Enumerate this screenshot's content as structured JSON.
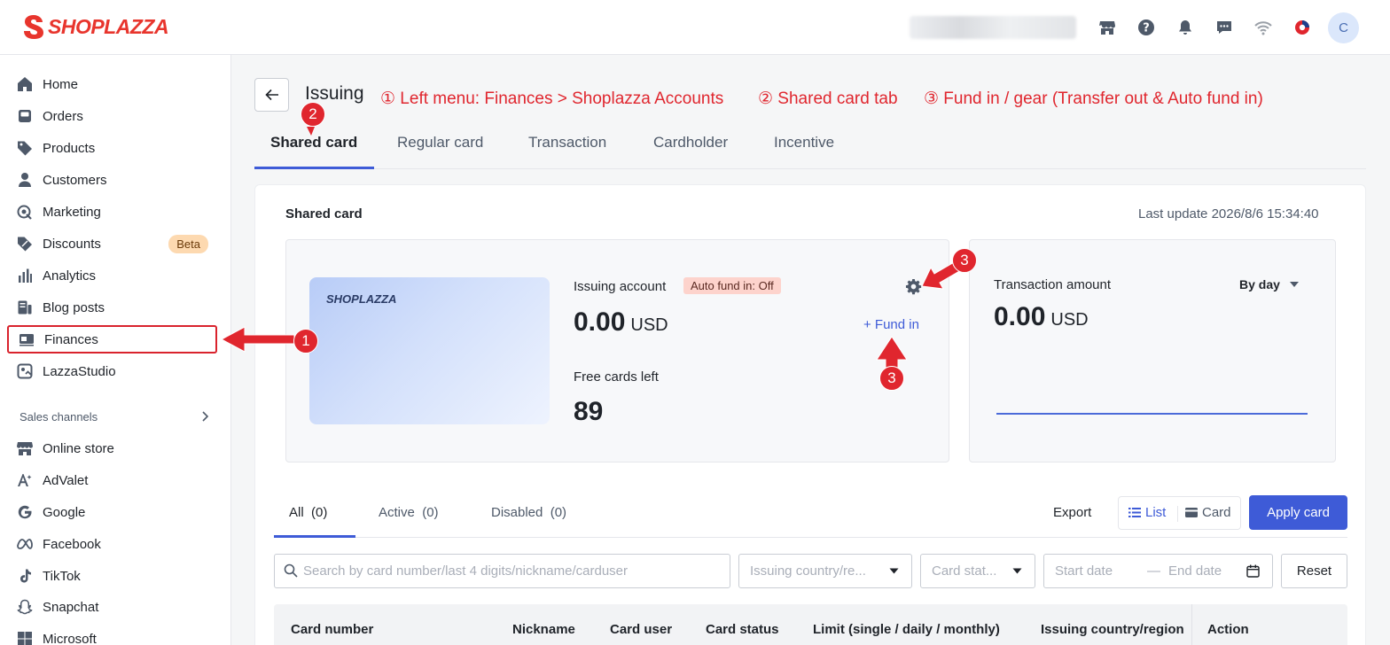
{
  "brand": {
    "name": "SHOPLAZZA"
  },
  "topbar": {
    "icons": [
      "store-icon",
      "help-icon",
      "bell-icon",
      "chat-icon",
      "wifi-icon",
      "app-icon"
    ],
    "avatar_initial": "C"
  },
  "sidebar": {
    "items": [
      {
        "label": "Home",
        "icon": "home-icon"
      },
      {
        "label": "Orders",
        "icon": "orders-icon"
      },
      {
        "label": "Products",
        "icon": "tag-icon"
      },
      {
        "label": "Customers",
        "icon": "person-icon"
      },
      {
        "label": "Marketing",
        "icon": "marketing-icon"
      },
      {
        "label": "Discounts",
        "icon": "discount-icon",
        "badge": "Beta"
      },
      {
        "label": "Analytics",
        "icon": "bar-chart-icon"
      },
      {
        "label": "Blog posts",
        "icon": "blog-icon"
      },
      {
        "label": "Finances",
        "icon": "finance-icon",
        "selected": true
      },
      {
        "label": "LazzaStudio",
        "icon": "studio-icon"
      }
    ],
    "sales_channels_title": "Sales channels",
    "channels": [
      {
        "label": "Online store",
        "icon": "store-icon"
      },
      {
        "label": "AdValet",
        "icon": "advalet-icon"
      },
      {
        "label": "Google",
        "icon": "google-icon"
      },
      {
        "label": "Facebook",
        "icon": "facebook-icon"
      },
      {
        "label": "TikTok",
        "icon": "tiktok-icon"
      },
      {
        "label": "Snapchat",
        "icon": "snapchat-icon"
      },
      {
        "label": "Microsoft",
        "icon": "microsoft-icon"
      }
    ]
  },
  "page": {
    "title": "Issuing",
    "annotations": [
      "① Left menu: Finances > Shoplazza Accounts",
      "② Shared card tab",
      "③ Fund in / gear (Transfer out & Auto fund in)"
    ],
    "badges": [
      "1",
      "2",
      "3",
      "3"
    ],
    "tabs": [
      "Shared card",
      "Regular card",
      "Transaction",
      "Cardholder",
      "Incentive"
    ],
    "active_tab": "Shared card"
  },
  "shared_card": {
    "title": "Shared card",
    "last_update": "Last update 2026/8/6 15:34:40",
    "card_brand": "SHOPLAZZA",
    "issuing_account_label": "Issuing account",
    "auto_fund_badge": "Auto fund in: Off",
    "balance": "0.00",
    "currency": "USD",
    "fund_in_link": "+ Fund in",
    "free_cards_label": "Free cards left",
    "free_cards_value": "89",
    "transaction_label": "Transaction amount",
    "period_select": "By day",
    "transaction_amount": "0.00",
    "transaction_currency": "USD"
  },
  "list": {
    "filter_tabs": [
      {
        "label": "All",
        "count": "(0)"
      },
      {
        "label": "Active",
        "count": "(0)"
      },
      {
        "label": "Disabled",
        "count": "(0)"
      }
    ],
    "export_label": "Export",
    "view_list": "List",
    "view_card": "Card",
    "apply_button": "Apply card",
    "search_placeholder": "Search by card number/last 4 digits/nickname/carduser",
    "country_placeholder": "Issuing country/re...",
    "status_placeholder": "Card stat...",
    "start_date": "Start date",
    "date_separator": "—",
    "end_date": "End date",
    "reset_button": "Reset",
    "columns": [
      "Card number",
      "Nickname",
      "Card user",
      "Card status",
      "Limit (single / daily / monthly)",
      "Issuing country/region",
      "Action"
    ]
  },
  "colors": {
    "brand_red": "#e8352d",
    "accent_blue": "#3e5bd7",
    "annotation_red": "#e0262e"
  }
}
